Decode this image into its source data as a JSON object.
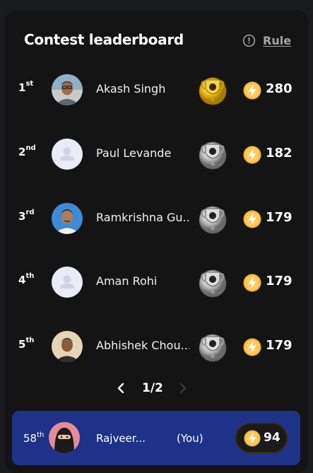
{
  "header": {
    "title": "Contest leaderboard",
    "rule_label": "Rule"
  },
  "leaderboard": [
    {
      "rank": "1",
      "suffix": "st",
      "name": "Akash Singh",
      "trophy": "gold-trophy-icon",
      "score": "280",
      "avatar": "photo"
    },
    {
      "rank": "2",
      "suffix": "nd",
      "name": "Paul Levande",
      "trophy": "silver-trophy-icon",
      "score": "182",
      "avatar": "default"
    },
    {
      "rank": "3",
      "suffix": "rd",
      "name": "Ramkrishna Gu...",
      "trophy": "silver-trophy-icon",
      "score": "179",
      "avatar": "photo"
    },
    {
      "rank": "4",
      "suffix": "th",
      "name": "Aman Rohi",
      "trophy": "silver-trophy-icon",
      "score": "179",
      "avatar": "default"
    },
    {
      "rank": "5",
      "suffix": "th",
      "name": "Abhishek Chou...",
      "trophy": "silver-trophy-icon",
      "score": "179",
      "avatar": "photo"
    }
  ],
  "pager": {
    "label": "1/2"
  },
  "me": {
    "rank": "58",
    "suffix": "th",
    "name": "Rajveer...",
    "you_label": "(You)",
    "score": "94"
  },
  "colors": {
    "panel": "#141414",
    "me_bar": "#1e3288",
    "bolt": "#f5b73b",
    "gold": "#e8b923",
    "silver": "#c0c0c0"
  }
}
